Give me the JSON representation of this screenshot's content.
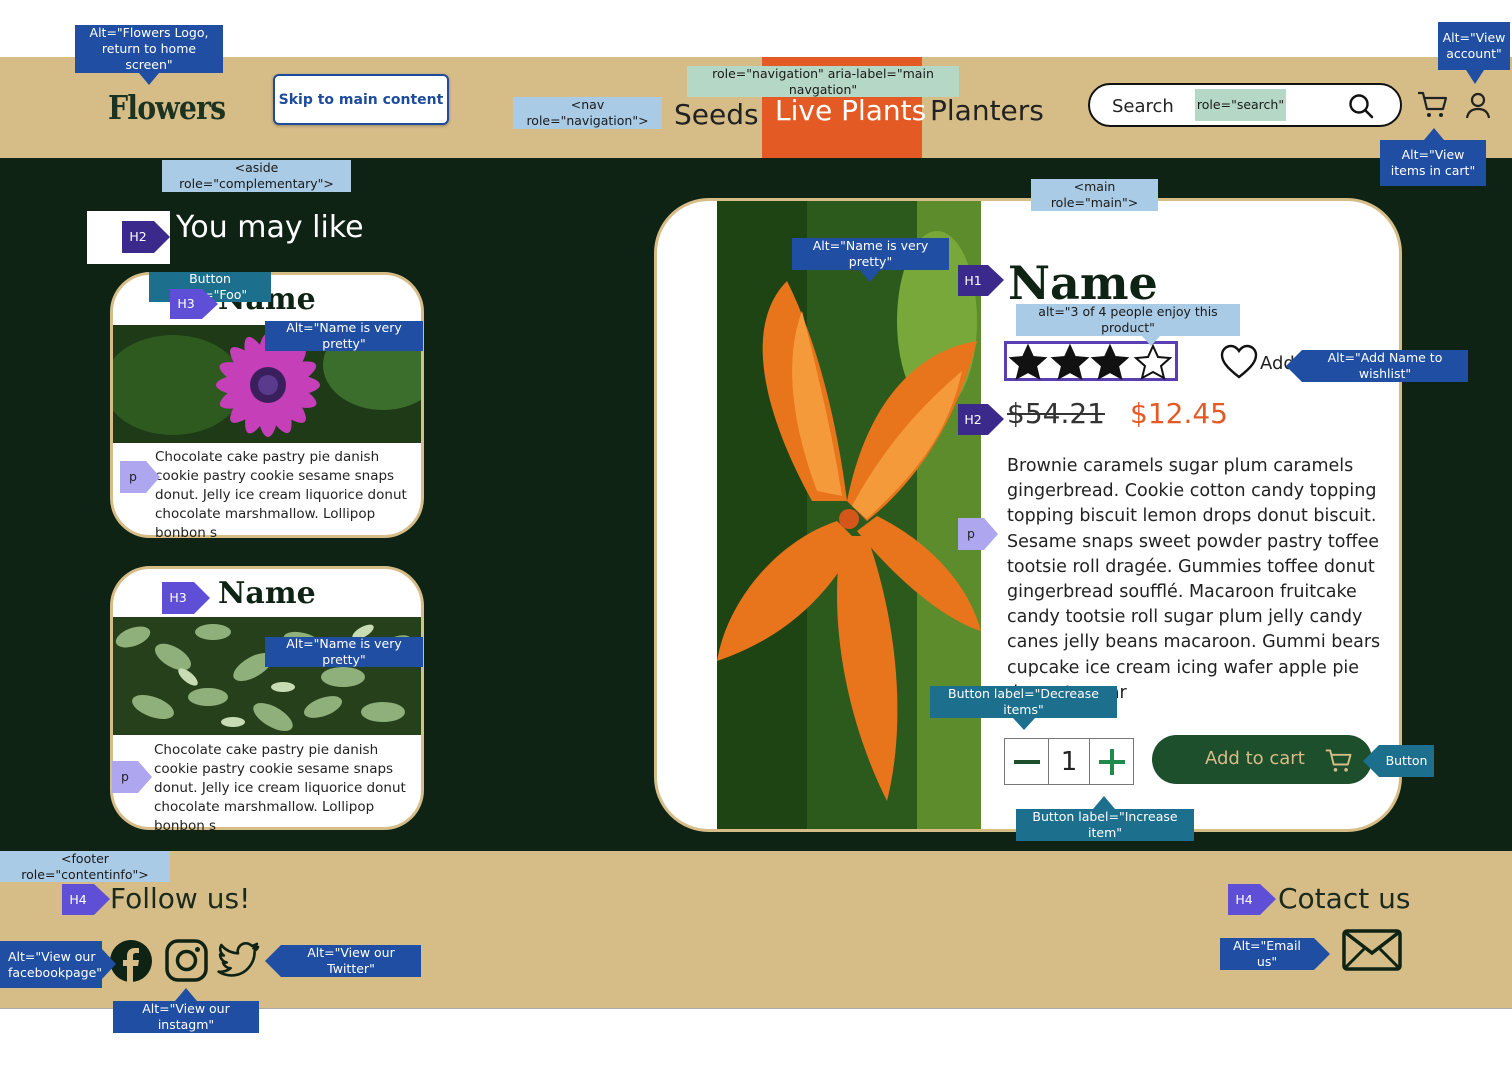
{
  "header": {
    "logo_text": "Flowers",
    "skip_link": "Skip to main content",
    "nav": [
      "Seeds",
      "Live Plants",
      "Planters"
    ],
    "search_placeholder": "Search"
  },
  "aside": {
    "title": "You may like",
    "cards": [
      {
        "title": "Name",
        "text": "Chocolate cake pastry pie danish cookie pastry cookie sesame snaps donut. Jelly ice cream liquorice donut chocolate marshmallow. Lollipop bonbon s"
      },
      {
        "title": "Name",
        "text": "Chocolate cake pastry pie danish cookie pastry cookie sesame snaps donut. Jelly ice cream liquorice donut chocolate marshmallow. Lollipop bonbon s"
      }
    ]
  },
  "product": {
    "title": "Name",
    "rating": 3,
    "rating_max": 4,
    "wishlist_label": "Add",
    "old_price": "$54.21",
    "price": "$12.45",
    "description": "Brownie caramels sugar plum caramels gingerbread. Cookie cotton candy topping topping biscuit lemon drops donut biscuit. Sesame snaps sweet powder pastry toffee tootsie roll dragée. Gummies toffee donut gingerbread soufflé. Macaroon fruitcake candy tootsie roll sugar plum jelly candy canes jelly beans macaroon. Gummi bears cupcake ice cream icing wafer apple pie dessert sugar",
    "quantity": "1",
    "add_to_cart": "Add to cart"
  },
  "footer": {
    "follow_title": "Follow us!",
    "contact_title": "Cotact us"
  },
  "annotations": {
    "logo": "Alt=\"Flowers Logo, return to home screen\"",
    "account": "Alt=\"View account\"",
    "cart": "Alt=\"View items in cart\"",
    "main_nav": "role=\"navigation\" aria-label=\"main navgation\"",
    "nav": "<nav role=\"navigation\">",
    "search": "role=\"search\"",
    "aside": "<aside role=\"complementary\">",
    "main": "<main role=\"main\">",
    "h2": "H2",
    "h3": "H3",
    "h1": "H1",
    "h4": "H4",
    "p": "p",
    "button_foo": "Button label=\"Foo\"",
    "alt_pretty": "Alt=\"Name is very pretty\"",
    "alt_rating": "alt=\"3 of 4 people enjoy this product\"",
    "alt_wishlist": "Alt=\"Add Name to wishlist\"",
    "decrease": "Button label=\"Decrease items\"",
    "increase": "Button label=\"Increase item\"",
    "button": "Button",
    "footer": "<footer role=\"contentinfo\">",
    "facebook": "Alt=\"View our facebookpage\"",
    "twitter": "Alt=\"View our Twitter\"",
    "instagram": "Alt=\"View our instagm\"",
    "email": "Alt=\"Email us\""
  },
  "colors": {
    "header_bg": "#d6bd88",
    "body_bg": "#0e2314",
    "accent": "#e45a25",
    "button_green": "#1d4f2c",
    "price_sale": "#e45a25"
  }
}
